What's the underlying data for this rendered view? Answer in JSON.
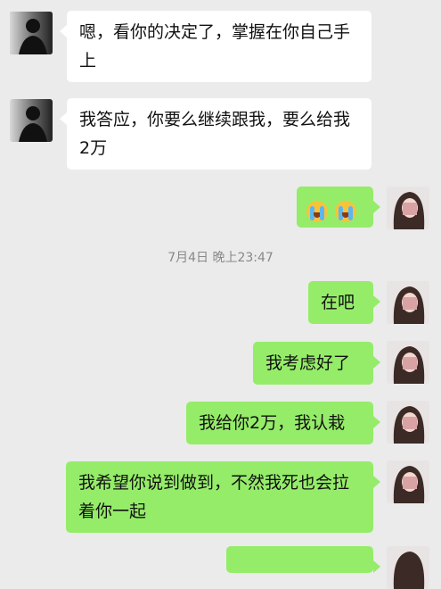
{
  "messages": [
    {
      "side": "left",
      "text": "嗯，看你的决定了，掌握在你自己手上"
    },
    {
      "side": "left",
      "text": "我答应，你要么继续跟我，要么给我2万"
    },
    {
      "side": "right",
      "emoji": [
        "crying-face",
        "crying-face"
      ]
    },
    {
      "side": "right",
      "text": "在吧"
    },
    {
      "side": "right",
      "text": "我考虑好了"
    },
    {
      "side": "right",
      "text": "我给你2万，我认栽"
    },
    {
      "side": "right",
      "text": "我希望你说到做到，不然我死也会拉着你一起"
    }
  ],
  "timestamp": "7月4日 晚上23:47",
  "colors": {
    "background": "#ebebeb",
    "left_bubble": "#ffffff",
    "right_bubble": "#95ec69"
  }
}
